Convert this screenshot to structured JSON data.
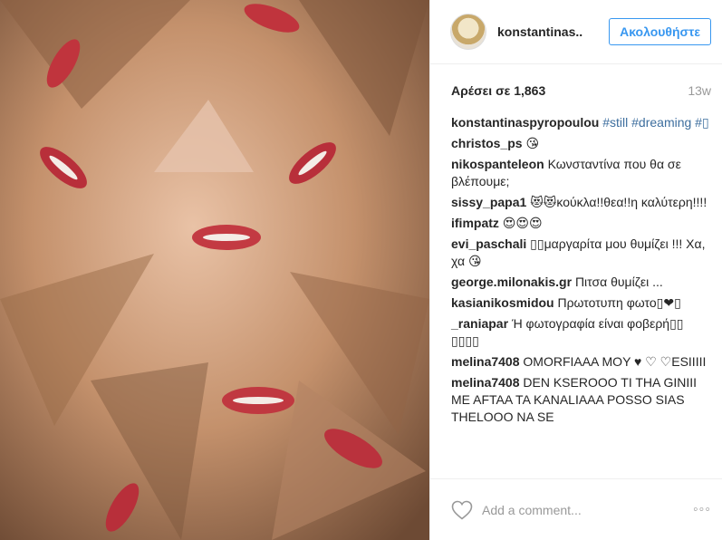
{
  "post": {
    "username": "konstantinas..",
    "follow_label": "Ακολουθήστε",
    "likes_text": "Αρέσει σε 1,863",
    "time_ago": "13w"
  },
  "caption": {
    "user": "konstantinaspyropoulou",
    "tags": "#still #dreaming #▯"
  },
  "comments": [
    {
      "user": "christos_ps",
      "text": "😘"
    },
    {
      "user": "nikospanteleon",
      "text": "Κωνσταντίνα που θα σε βλέπουμε;"
    },
    {
      "user": "sissy_papa1",
      "text": "😻😻κούκλα!!θεα!!η καλύτερη!!!!"
    },
    {
      "user": "ifimpatz",
      "text": "😍😍😍"
    },
    {
      "user": "evi_paschali",
      "text": "▯▯μαργαρίτα μου θυμίζει !!! Χα, χα 😘"
    },
    {
      "user": "george.milonakis.gr",
      "text": "Πιτσα θυμίζει ..."
    },
    {
      "user": "kasianikosmidou",
      "text": "Πρωτοτυπη φωτο▯❤▯"
    },
    {
      "user": "_raniapar",
      "text": "Ή φωτογραφία είναι φοβερή▯▯ ▯▯▯▯"
    },
    {
      "user": "melina7408",
      "text": "OMORFIAAA MOY ♥ ♡ ♡ESIIIII"
    },
    {
      "user": "melina7408",
      "text": "DEN KSEROOO TI THA GINIII ME AFTAA TA KANALIAAA POSSO SIAS THELOOO NA SE"
    }
  ],
  "footer": {
    "add_comment_placeholder": "Add a comment...",
    "more_label": "◦◦◦"
  }
}
